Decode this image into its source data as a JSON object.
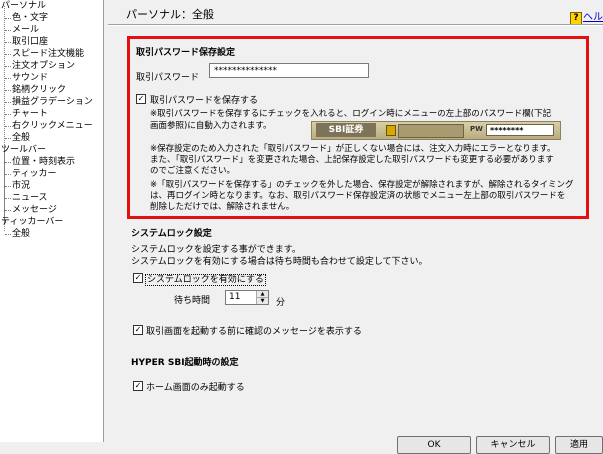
{
  "tree": {
    "items": [
      "パーソナル",
      "色・文字",
      "メール",
      "取引口座",
      "スピード注文機能",
      "注文オプション",
      "サウンド",
      "銘柄クリック",
      "損益グラデーション",
      "チャート",
      "右クリックメニュー",
      "全般",
      "ツールバー",
      "位置・時刻表示",
      "ティッカー",
      "市況",
      "ニュース",
      "メッセージ",
      "ティッカーバー",
      "全般"
    ]
  },
  "header": {
    "title": "パーソナル：全般",
    "help": "ヘルプ"
  },
  "password_section": {
    "heading": "取引パスワード保存設定",
    "label": "取引パスワード",
    "value": "**************",
    "save_checkbox_label": "取引パスワードを保存する",
    "save_checked": true,
    "desc1_line1": "※取引パスワードを保存するにチェックを入れると、ログイン時にメニューの左上部のパスワード欄(下記",
    "desc1_line2": "画面参照)に自動入力されます。",
    "banner_logo": "SBI証券",
    "banner_pw_label": "PW",
    "banner_pw_value": "********",
    "note2_line1": "※保存設定のため入力された「取引パスワード」が正しくない場合には、注文入力時にエラーとなります。",
    "note2_line2": "また、「取引パスワード」を変更された場合、上記保存設定した取引パスワードも変更する必要があります",
    "note2_line3": "のでご注意ください。",
    "note3_line1": "※「取引パスワードを保存する」のチェックを外した場合、保存設定が解除されますが、解除されるタイミング",
    "note3_line2": "は、再ログイン時となります。なお、取引パスワード保存設定済の状態でメニュー左上部の取引パスワードを",
    "note3_line3": "削除しただけでは、解除されません。"
  },
  "system_lock": {
    "heading": "システムロック設定",
    "desc_line1": "システムロックを設定する事ができます。",
    "desc_line2": "システムロックを有効にする場合は待ち時間も合わせて設定して下さい。",
    "enable_label": "システムロックを有効にする",
    "enable_checked": true,
    "wait_label": "待ち時間",
    "wait_value": "11",
    "wait_unit": "分",
    "confirm_label": "取引画面を起動する前に確認のメッセージを表示する",
    "confirm_checked": true
  },
  "hyper_sbi": {
    "heading": "HYPER SBI起動時の設定",
    "home_only_label": "ホーム画面のみ起動する",
    "home_only_checked": true
  },
  "buttons": {
    "ok": "OK",
    "cancel": "キャンセル",
    "apply": "適用"
  }
}
